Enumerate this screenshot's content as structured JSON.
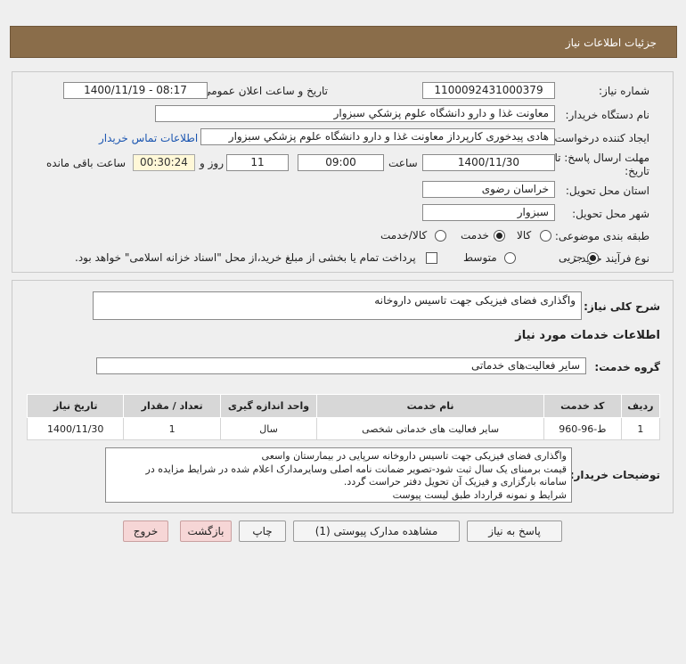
{
  "header": {
    "title": "جزئیات اطلاعات نیاز"
  },
  "form": {
    "need_number_label": "شماره نیاز:",
    "need_number": "1100092431000379",
    "announce_label": "تاریخ و ساعت اعلان عمومی:",
    "announce_value": "1400/11/19 - 08:17",
    "buyer_label": "نام دستگاه خریدار:",
    "buyer_value": "معاونت غذا و دارو   دانشگاه علوم پزشکي سبزوار",
    "requester_label": "ایجاد کننده درخواست:",
    "requester_value": "هادی پیدخوری کارپرداز معاونت غذا و دارو   دانشگاه علوم پزشکي سبزوار",
    "contact_link": "اطلاعات تماس خریدار",
    "deadline_label_1": "مهلت ارسال پاسخ: تا",
    "deadline_label_2": "تاریخ:",
    "deadline_date": "1400/11/30",
    "time_label": "ساعت",
    "deadline_time": "09:00",
    "days_value": "11",
    "days_label": "روز و",
    "remaining_time": "00:30:24",
    "remaining_label": "ساعت باقی مانده",
    "province_label": "استان محل تحویل:",
    "province_value": "خراسان رضوی",
    "city_label": "شهر محل تحویل:",
    "city_value": "سبزوار",
    "category_label": "طبقه بندی موضوعی:",
    "category_options": [
      "کالا",
      "خدمت",
      "کالا/خدمت"
    ],
    "category_selected": "خدمت",
    "process_label": "نوع فرآیند خرید :",
    "process_options": [
      "جزیی",
      "متوسط"
    ],
    "process_selected": "جزیی",
    "payment_note": "پرداخت تمام یا بخشی از مبلغ خرید،از محل \"اسناد خزانه اسلامی\" خواهد بود."
  },
  "summary": {
    "label": "شرح کلی نیاز:",
    "value": "واگذاری فضای فیزیکی جهت تاسیس داروخانه"
  },
  "services": {
    "section_title": "اطلاعات خدمات مورد نیاز",
    "group_label": "گروه خدمت:",
    "group_value": "سایر فعالیت‌های خدماتی",
    "table": {
      "headers": [
        "ردیف",
        "کد خدمت",
        "نام خدمت",
        "واحد اندازه گیری",
        "تعداد / مقدار",
        "تاریخ نیاز"
      ],
      "rows": [
        [
          "1",
          "ط-96-960",
          "سایر فعالیت های خدماتی شخصی",
          "سال",
          "1",
          "1400/11/30"
        ]
      ]
    }
  },
  "buyer_notes": {
    "label": "توضیحات خریدار:",
    "lines": [
      "واگذاری فضای فیزیکی جهت تاسیس داروخانه سرپایی در بیمارستان واسعی",
      "قیمت برمبنای یک سال ثبت شود-تصویر ضمانت نامه اصلی وسایرمدارک اعلام شده در شرایط مزایده در",
      "سامانه بارگزاری و فیزیک آن تحویل دفتر حراست گردد.",
      "شرایط و نمونه قرارداد طبق لیست پیوست"
    ]
  },
  "buttons": {
    "reply": "پاسخ به نیاز",
    "attachments": "مشاهده مدارک پیوستی (1)",
    "print": "چاپ",
    "back": "بازگشت",
    "exit": "خروج"
  },
  "colors": {
    "titlebar": "#8a6d4a",
    "link": "#1a55b0",
    "remaining_bg": "#fff8d8",
    "danger_btn": "#f6d6d6"
  }
}
